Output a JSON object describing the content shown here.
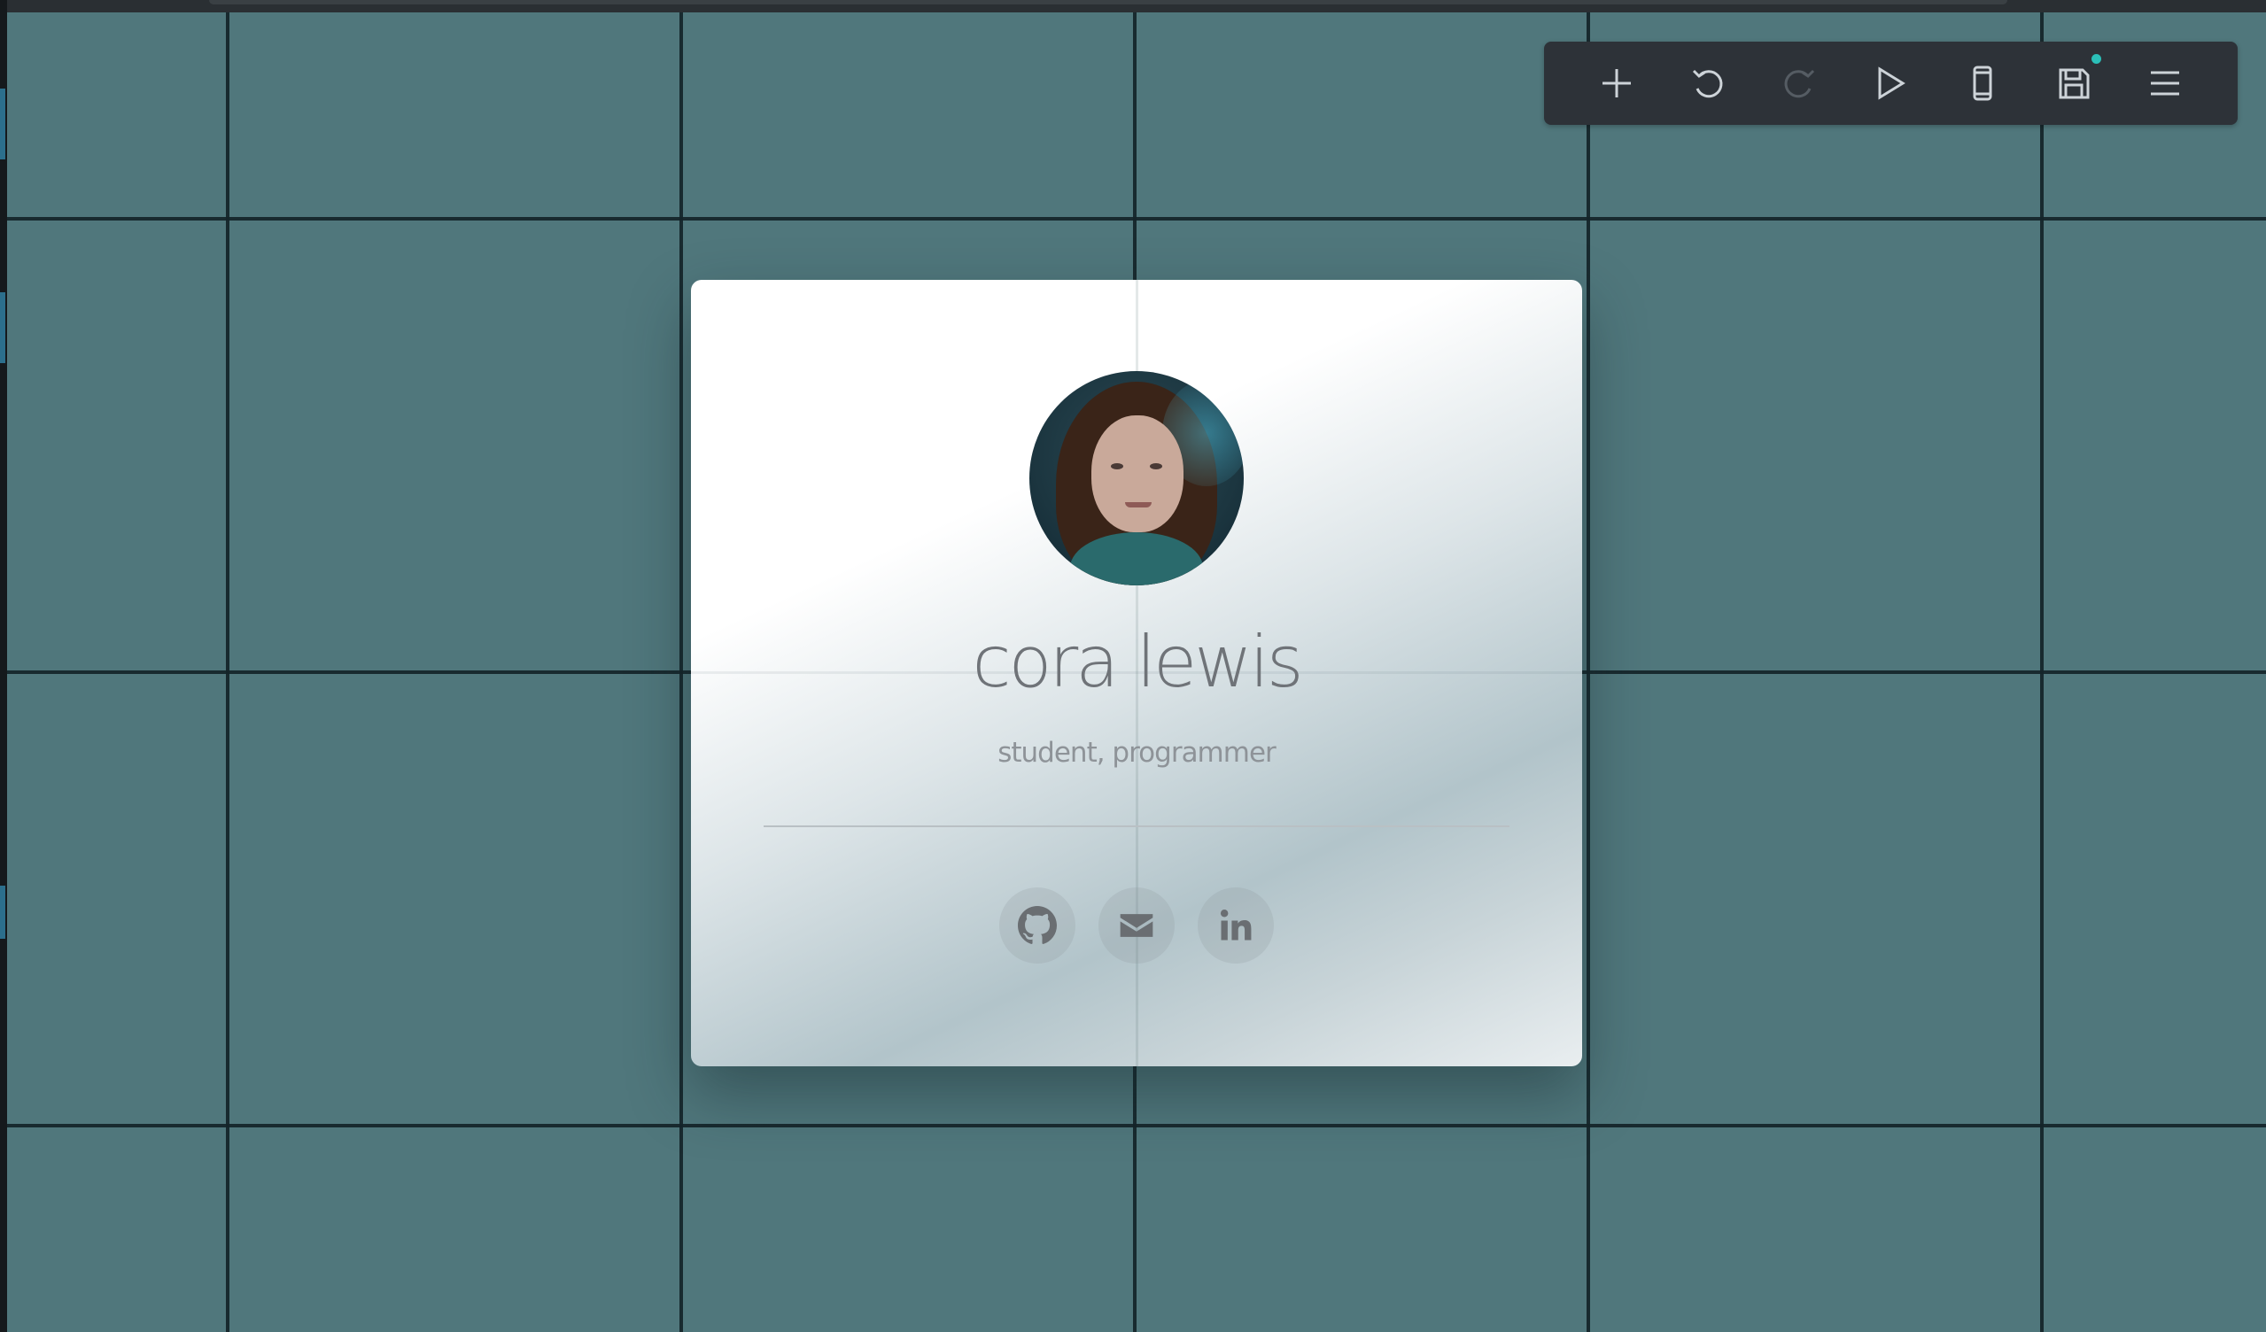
{
  "toolbar": {
    "buttons": [
      {
        "name": "add",
        "icon": "plus-icon"
      },
      {
        "name": "undo",
        "icon": "undo-icon"
      },
      {
        "name": "redo",
        "icon": "redo-icon",
        "disabled": true
      },
      {
        "name": "preview",
        "icon": "play-icon"
      },
      {
        "name": "device",
        "icon": "phone-icon"
      },
      {
        "name": "save",
        "icon": "save-icon",
        "unsaved_indicator": true
      },
      {
        "name": "menu",
        "icon": "hamburger-icon"
      }
    ]
  },
  "profile": {
    "name": "cora lewis",
    "tagline": "student, programmer",
    "avatar_icon": "profile-photo",
    "links": [
      {
        "name": "github",
        "icon": "github-icon"
      },
      {
        "name": "email",
        "icon": "envelope-icon"
      },
      {
        "name": "linkedin",
        "icon": "linkedin-icon"
      }
    ]
  },
  "colors": {
    "canvas_bg": "#50777c",
    "grid_line": "#142428",
    "toolbar_bg": "#2d3238",
    "accent_dot": "#2bbfb8",
    "name_text": "#6f7378"
  }
}
